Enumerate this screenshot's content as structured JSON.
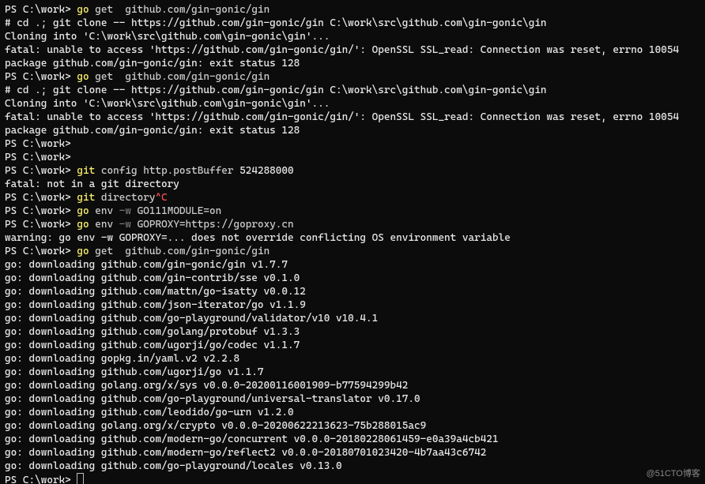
{
  "lines": [
    {
      "segs": [
        {
          "t": "PS ",
          "c": "white"
        },
        {
          "t": "C:\\work> ",
          "c": "white"
        },
        {
          "t": "go ",
          "c": "yellow"
        },
        {
          "t": "get  github.com/gin-gonic/gin",
          "c": "cmd"
        }
      ]
    },
    {
      "segs": [
        {
          "t": "# cd .; git clone -- https://github.com/gin-gonic/gin C:\\work\\src\\github.com\\gin-gonic\\gin",
          "c": "white"
        }
      ]
    },
    {
      "segs": [
        {
          "t": "Cloning into 'C:\\work\\src\\github.com\\gin-gonic\\gin'...",
          "c": "white"
        }
      ]
    },
    {
      "segs": [
        {
          "t": "fatal: unable to access 'https://github.com/gin-gonic/gin/': OpenSSL SSL_read: Connection was reset, errno 10054",
          "c": "white"
        }
      ]
    },
    {
      "segs": [
        {
          "t": "package github.com/gin-gonic/gin: exit status 128",
          "c": "white"
        }
      ]
    },
    {
      "segs": [
        {
          "t": "PS ",
          "c": "white"
        },
        {
          "t": "C:\\work> ",
          "c": "white"
        },
        {
          "t": "go ",
          "c": "yellow"
        },
        {
          "t": "get  github.com/gin-gonic/gin",
          "c": "cmd"
        }
      ]
    },
    {
      "segs": [
        {
          "t": "# cd .; git clone -- https://github.com/gin-gonic/gin C:\\work\\src\\github.com\\gin-gonic\\gin",
          "c": "white"
        }
      ]
    },
    {
      "segs": [
        {
          "t": "Cloning into 'C:\\work\\src\\github.com\\gin-gonic\\gin'...",
          "c": "white"
        }
      ]
    },
    {
      "segs": [
        {
          "t": "fatal: unable to access 'https://github.com/gin-gonic/gin/': OpenSSL SSL_read: Connection was reset, errno 10054",
          "c": "white"
        }
      ]
    },
    {
      "segs": [
        {
          "t": "package github.com/gin-gonic/gin: exit status 128",
          "c": "white"
        }
      ]
    },
    {
      "segs": [
        {
          "t": "PS ",
          "c": "white"
        },
        {
          "t": "C:\\work>",
          "c": "white"
        }
      ]
    },
    {
      "segs": [
        {
          "t": "PS ",
          "c": "white"
        },
        {
          "t": "C:\\work>",
          "c": "white"
        }
      ]
    },
    {
      "segs": [
        {
          "t": "PS ",
          "c": "white"
        },
        {
          "t": "C:\\work> ",
          "c": "white"
        },
        {
          "t": "git ",
          "c": "yellow"
        },
        {
          "t": "config http.postBuffer ",
          "c": "cmd"
        },
        {
          "t": "524288000",
          "c": "white"
        }
      ]
    },
    {
      "segs": [
        {
          "t": "fatal: not in a git directory",
          "c": "white"
        }
      ]
    },
    {
      "segs": [
        {
          "t": "PS ",
          "c": "white"
        },
        {
          "t": "C:\\work> ",
          "c": "white"
        },
        {
          "t": "git ",
          "c": "yellow"
        },
        {
          "t": "directory",
          "c": "cmd"
        },
        {
          "t": "^C",
          "c": "ctrlc"
        }
      ]
    },
    {
      "segs": [
        {
          "t": "PS ",
          "c": "white"
        },
        {
          "t": "C:\\work> ",
          "c": "white"
        },
        {
          "t": "go ",
          "c": "yellow"
        },
        {
          "t": "env ",
          "c": "cmd"
        },
        {
          "t": "-w ",
          "c": "grey"
        },
        {
          "t": "GO111MODULE=on",
          "c": "cmd"
        }
      ]
    },
    {
      "segs": [
        {
          "t": "PS ",
          "c": "white"
        },
        {
          "t": "C:\\work> ",
          "c": "white"
        },
        {
          "t": "go ",
          "c": "yellow"
        },
        {
          "t": "env ",
          "c": "cmd"
        },
        {
          "t": "-w ",
          "c": "grey"
        },
        {
          "t": "GOPROXY=https://goproxy.cn",
          "c": "cmd"
        }
      ]
    },
    {
      "segs": [
        {
          "t": "warning: go env -w GOPROXY=... does not override conflicting OS environment variable",
          "c": "white"
        }
      ]
    },
    {
      "segs": [
        {
          "t": "PS ",
          "c": "white"
        },
        {
          "t": "C:\\work> ",
          "c": "white"
        },
        {
          "t": "go ",
          "c": "yellow"
        },
        {
          "t": "get  github.com/gin-gonic/gin",
          "c": "cmd"
        }
      ]
    },
    {
      "segs": [
        {
          "t": "go: downloading github.com/gin-gonic/gin v1.7.7",
          "c": "white"
        }
      ]
    },
    {
      "segs": [
        {
          "t": "go: downloading github.com/gin-contrib/sse v0.1.0",
          "c": "white"
        }
      ]
    },
    {
      "segs": [
        {
          "t": "go: downloading github.com/mattn/go-isatty v0.0.12",
          "c": "white"
        }
      ]
    },
    {
      "segs": [
        {
          "t": "go: downloading github.com/json-iterator/go v1.1.9",
          "c": "white"
        }
      ]
    },
    {
      "segs": [
        {
          "t": "go: downloading github.com/go-playground/validator/v10 v10.4.1",
          "c": "white"
        }
      ]
    },
    {
      "segs": [
        {
          "t": "go: downloading github.com/golang/protobuf v1.3.3",
          "c": "white"
        }
      ]
    },
    {
      "segs": [
        {
          "t": "go: downloading github.com/ugorji/go/codec v1.1.7",
          "c": "white"
        }
      ]
    },
    {
      "segs": [
        {
          "t": "go: downloading gopkg.in/yaml.v2 v2.2.8",
          "c": "white"
        }
      ]
    },
    {
      "segs": [
        {
          "t": "go: downloading github.com/ugorji/go v1.1.7",
          "c": "white"
        }
      ]
    },
    {
      "segs": [
        {
          "t": "go: downloading golang.org/x/sys v0.0.0-20200116001909-b77594299b42",
          "c": "white"
        }
      ]
    },
    {
      "segs": [
        {
          "t": "go: downloading github.com/go-playground/universal-translator v0.17.0",
          "c": "white"
        }
      ]
    },
    {
      "segs": [
        {
          "t": "go: downloading github.com/leodido/go-urn v1.2.0",
          "c": "white"
        }
      ]
    },
    {
      "segs": [
        {
          "t": "go: downloading golang.org/x/crypto v0.0.0-20200622213623-75b288015ac9",
          "c": "white"
        }
      ]
    },
    {
      "segs": [
        {
          "t": "go: downloading github.com/modern-go/concurrent v0.0.0-20180228061459-e0a39a4cb421",
          "c": "white"
        }
      ]
    },
    {
      "segs": [
        {
          "t": "go: downloading github.com/modern-go/reflect2 v0.0.0-20180701023420-4b7aa43c6742",
          "c": "white"
        }
      ]
    },
    {
      "segs": [
        {
          "t": "go: downloading github.com/go-playground/locales v0.13.0",
          "c": "white"
        }
      ]
    },
    {
      "segs": [
        {
          "t": "PS ",
          "c": "white"
        },
        {
          "t": "C:\\work> ",
          "c": "white"
        }
      ],
      "cursor": true
    }
  ],
  "watermark": "@51CTO博客"
}
